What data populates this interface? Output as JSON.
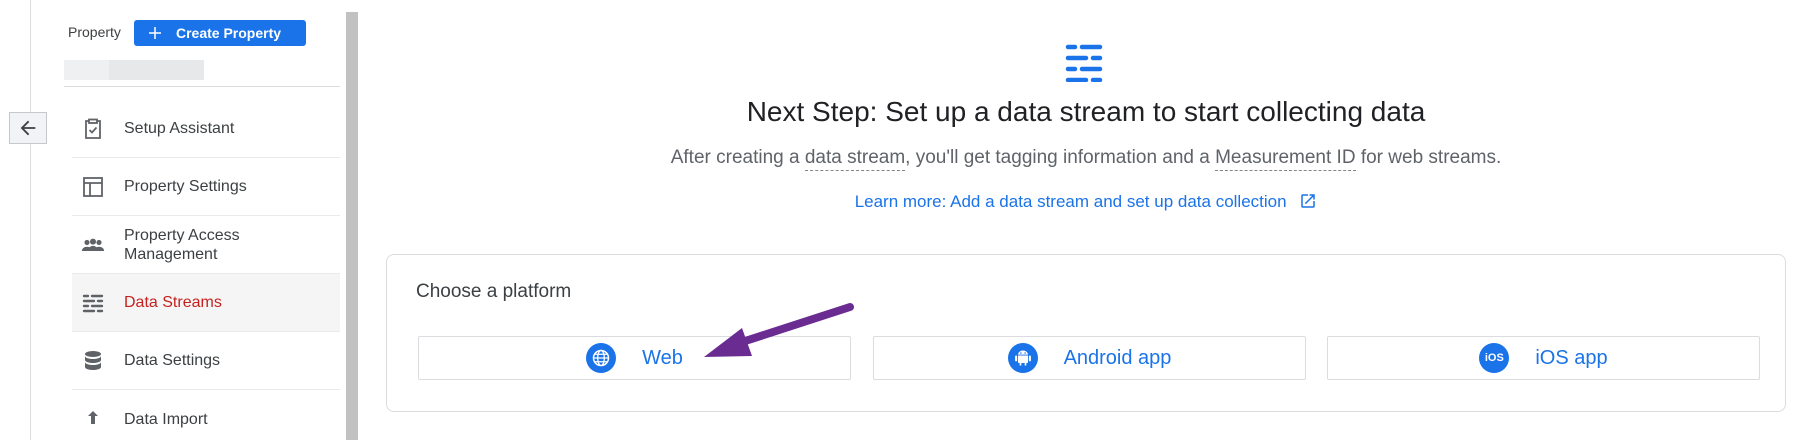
{
  "sidebar": {
    "property_label": "Property",
    "create_button_label": "Create Property",
    "nav_items": [
      {
        "label": "Setup Assistant",
        "icon": "clipboard-check-icon"
      },
      {
        "label": "Property Settings",
        "icon": "layout-icon"
      },
      {
        "label": "Property Access Management",
        "icon": "people-icon"
      },
      {
        "label": "Data Streams",
        "icon": "data-streams-icon",
        "active": true
      },
      {
        "label": "Data Settings",
        "icon": "database-icon"
      },
      {
        "label": "Data Import",
        "icon": "upload-icon"
      }
    ]
  },
  "main": {
    "heading": "Next Step: Set up a data stream to start collecting data",
    "subtext": {
      "part1": "After creating a ",
      "term1": "data stream",
      "part2": ", you'll get tagging information and a ",
      "term2": "Measurement ID",
      "part3": " for web streams."
    },
    "learn_more_link": "Learn more: Add a data stream and set up data collection",
    "platform_card": {
      "title": "Choose a platform",
      "options": [
        {
          "label": "Web",
          "icon": "globe-icon"
        },
        {
          "label": "Android app",
          "icon": "android-icon"
        },
        {
          "label": "iOS app",
          "icon": "ios-icon",
          "icon_text": "iOS"
        }
      ]
    }
  },
  "colors": {
    "accent": "#1a73e8",
    "active_nav_text": "#c5221f",
    "annotation_arrow": "#6a2c91"
  }
}
